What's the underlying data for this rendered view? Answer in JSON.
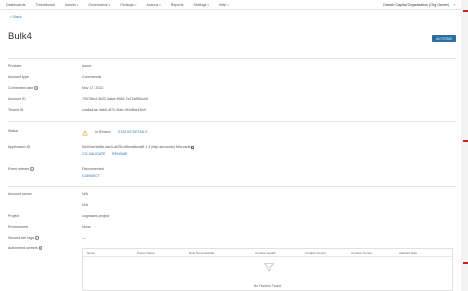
{
  "nav": {
    "items": [
      {
        "label": "Dashboards",
        "caret": false
      },
      {
        "label": "Threatboard",
        "caret": false
      },
      {
        "label": "Assets",
        "caret": true
      },
      {
        "label": "Governance",
        "caret": true
      },
      {
        "label": "Findings",
        "caret": true
      },
      {
        "label": "Actions",
        "caret": true
      },
      {
        "label": "Reports",
        "caret": false
      },
      {
        "label": "Settings",
        "caret": true
      },
      {
        "label": "Help",
        "caret": true
      }
    ],
    "org": "Darwin Capital Organization (Org Owner)"
  },
  "back_label": "< Back",
  "title": "Bulk4",
  "actions_label": "ACTIONS",
  "details": [
    {
      "label": "Provider",
      "value": "Azure"
    },
    {
      "label": "Account type",
      "value": "Commercial"
    },
    {
      "label": "Connected date",
      "value": "Nov 17, 2022",
      "info": true
    },
    {
      "label": "Account ID",
      "value": "79378bcf-3b02-4aba-9984-7a71a5f5cce6"
    },
    {
      "label": "Tenant ID",
      "value": "c4a6a1ae-4ab5-4f72-9fab-2f0c8be43fc0"
    }
  ],
  "status": {
    "label": "Status",
    "text": "In Review",
    "link": "STATUS DETAILS"
  },
  "application": {
    "label": "Application ID",
    "value": "f4c92ae4e8fa-4ac9-a026-e6bea8bea8f 1 3 (http accounts) Microsoft",
    "links": [
      "CO-VALIDATE",
      "RENAME"
    ]
  },
  "event_stream": {
    "label": "Event stream",
    "value": "Disconnected",
    "link": "CONNECT"
  },
  "fields": [
    {
      "label": "Account owner",
      "value": "N/A"
    },
    {
      "label": "",
      "value": "N/A"
    },
    {
      "label": "Project",
      "value": "cognisant-project"
    },
    {
      "label": "Environment",
      "value": "None"
    },
    {
      "label": "Second-tier tags",
      "value": "—",
      "info": true
    },
    {
      "label": "Authorized owners",
      "value": "",
      "info": true
    }
  ],
  "table": {
    "columns": [
      "Name",
      "Owner Name",
      "Role Name/Handle",
      "Creation Health",
      "Creation Period",
      "Creation Period",
      "Attested Date"
    ],
    "empty_text": "No Owners Found"
  },
  "colors": {
    "accent": "#2a6fa0",
    "link": "#2a78b8",
    "warning": "#f2a33a"
  }
}
